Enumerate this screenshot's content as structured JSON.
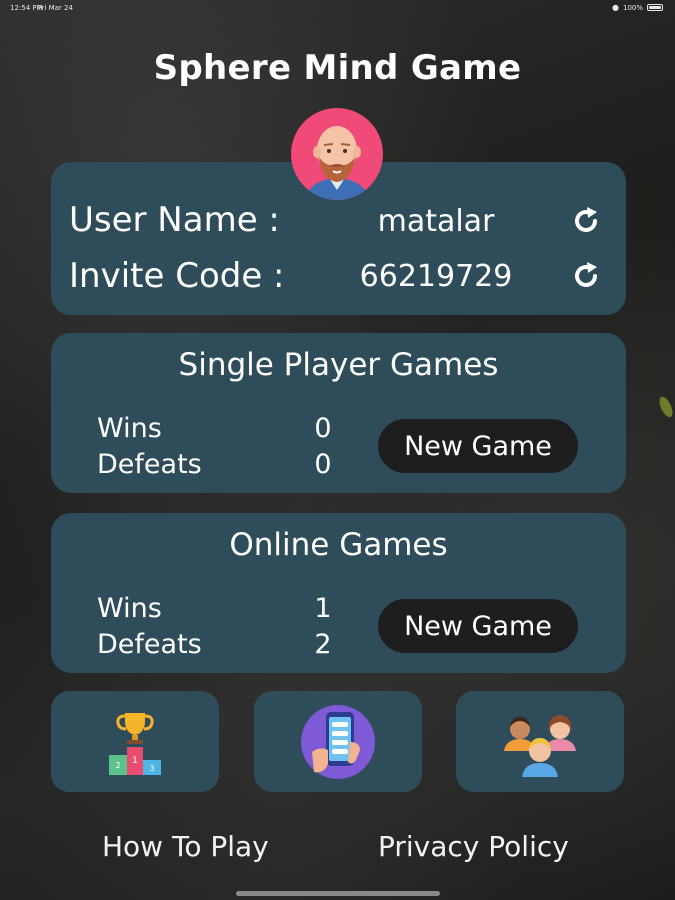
{
  "status_bar": {
    "time": "12:54 PM",
    "date": "Fri Mar 24",
    "battery": "100%"
  },
  "app": {
    "title": "Sphere Mind Game"
  },
  "profile": {
    "user_name_label": "User Name :",
    "user_name_value": "matalar",
    "invite_code_label": "Invite Code :",
    "invite_code_value": "66219729"
  },
  "single_player": {
    "title": "Single Player Games",
    "wins_label": "Wins",
    "wins_value": "0",
    "defeats_label": "Defeats",
    "defeats_value": "0",
    "new_game_label": "New Game"
  },
  "online": {
    "title": "Online Games",
    "wins_label": "Wins",
    "wins_value": "1",
    "defeats_label": "Defeats",
    "defeats_value": "2",
    "new_game_label": "New Game"
  },
  "tiles": [
    {
      "icon": "leaderboard-podium-icon"
    },
    {
      "icon": "phone-app-icon"
    },
    {
      "icon": "friends-group-icon"
    }
  ],
  "footer": {
    "how_to_play": "How To Play",
    "privacy_policy": "Privacy Policy"
  },
  "colors": {
    "card": "#2f4c5a",
    "button": "#1e1e1e",
    "avatar_bg": "#ef4a78"
  }
}
